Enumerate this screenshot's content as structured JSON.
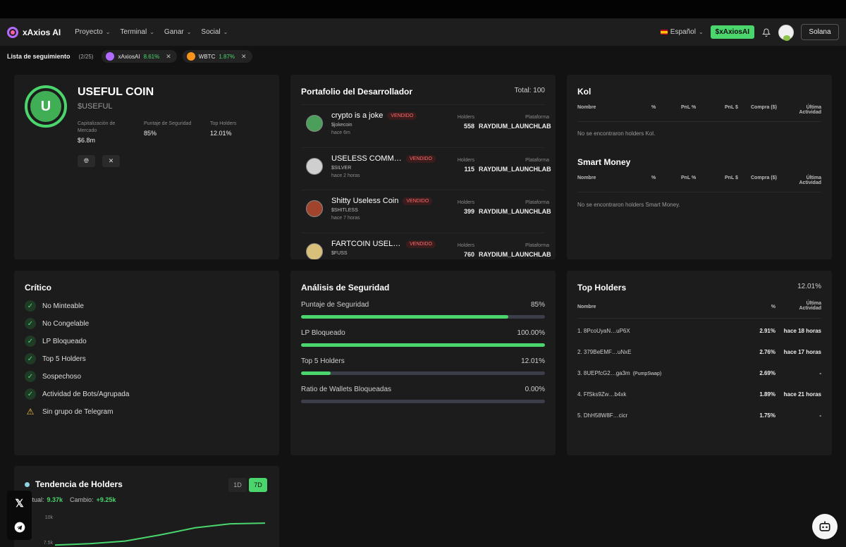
{
  "nav": {
    "brand": "xAxios AI",
    "items": [
      "Proyecto",
      "Terminal",
      "Ganar",
      "Social"
    ],
    "language": "Español",
    "token_button": "$xAxiosAI",
    "chain_button": "Solana"
  },
  "watchlist": {
    "title": "Lista de seguimiento",
    "count": "(2/25)",
    "chips": [
      {
        "name": "xAxiosAI",
        "change": "8.61%"
      },
      {
        "name": "WBTC",
        "change": "1.87%"
      }
    ]
  },
  "token": {
    "name": "USEFUL COIN",
    "symbol": "$USEFUL",
    "logo_letter": "U",
    "market_cap_label": "Capitalización de Mercado",
    "market_cap": "$6.8m",
    "security_label": "Puntaje de Seguridad",
    "security": "85%",
    "top_holders_label": "Top Holders",
    "top_holders": "12.01%"
  },
  "dev": {
    "title": "Portafolio del Desarrollador",
    "total": "Total: 100",
    "holders_label": "Holders",
    "platform_label": "Plataforma",
    "sold_label": "VENDIDO",
    "items": [
      {
        "name": "crypto is a joke",
        "symbol": "$jokecoin",
        "time": "hace 6m",
        "holders": "558",
        "platform": "RAYDIUM_LAUNCHLAB"
      },
      {
        "name": "USELESS COMMOD…",
        "symbol": "$SILVER",
        "time": "hace 2 horas",
        "holders": "115",
        "platform": "RAYDIUM_LAUNCHLAB"
      },
      {
        "name": "Shitty Useless Coin",
        "symbol": "$SHITLESS",
        "time": "hace 7 horas",
        "holders": "399",
        "platform": "RAYDIUM_LAUNCHLAB"
      },
      {
        "name": "FARTCOIN USELES…",
        "symbol": "$FUSS",
        "time": "",
        "holders": "760",
        "platform": "RAYDIUM_LAUNCHLAB"
      }
    ]
  },
  "kol": {
    "title": "Kol",
    "headers": [
      "Nombre",
      "%",
      "PnL %",
      "PnL $",
      "Compra ($)",
      "Última",
      "Actividad"
    ],
    "empty": "No se encontraron holders Kol."
  },
  "smart": {
    "title": "Smart Money",
    "empty": "No se encontraron holders Smart Money."
  },
  "critical": {
    "title": "Crítico",
    "items": [
      "No Minteable",
      "No Congelable",
      "LP Bloqueado",
      "Top 5 Holders",
      "Sospechoso",
      "Actividad de Bots/Agrupada",
      "Sin grupo de Telegram"
    ]
  },
  "security": {
    "title": "Análisis de Seguridad",
    "rows": [
      {
        "label": "Puntaje de Seguridad",
        "value": "85%",
        "fill": 0.85
      },
      {
        "label": "LP Bloqueado",
        "value": "100.00%",
        "fill": 1.0
      },
      {
        "label": "Top 5 Holders",
        "value": "12.01%",
        "fill": 0.12
      },
      {
        "label": "Ratio de Wallets Bloqueadas",
        "value": "0.00%",
        "fill": 0.0
      }
    ]
  },
  "top_holders": {
    "title": "Top Holders",
    "total": "12.01%",
    "col_name": "Nombre",
    "col_pct": "%",
    "col_act1": "Última",
    "col_act2": "Actividad",
    "rows": [
      {
        "name": "1. 8PcoUyaN…uP6X",
        "tag": "",
        "pct": "2.91%",
        "activity": "hace 18 horas"
      },
      {
        "name": "2. 379BeEMF…uNxE",
        "tag": "",
        "pct": "2.76%",
        "activity": "hace 17 horas"
      },
      {
        "name": "3. 8UEPfcG2…ga3m",
        "tag": "(PumpSwap)",
        "pct": "2.69%",
        "activity": "-"
      },
      {
        "name": "4. FfSks9Zw…b4xk",
        "tag": "",
        "pct": "1.89%",
        "activity": "hace 21 horas"
      },
      {
        "name": "5. DhH58W8F…cicr",
        "tag": "",
        "pct": "1.75%",
        "activity": "-"
      }
    ]
  },
  "trend": {
    "title": "Tendencia de Holders",
    "toggle_1d": "1D",
    "toggle_7d": "7D",
    "actual_label": "Actual:",
    "actual": "9.37k",
    "change_label": "Cambio:",
    "change": "+9.25k",
    "ticks": [
      "10k",
      "7.5k"
    ]
  },
  "chart_data": {
    "type": "line",
    "series": [
      {
        "values": [
          7.2,
          7.35,
          7.6,
          8.2,
          8.9,
          9.3,
          9.37
        ]
      }
    ],
    "yticks": [
      "10k",
      "7.5k"
    ]
  }
}
